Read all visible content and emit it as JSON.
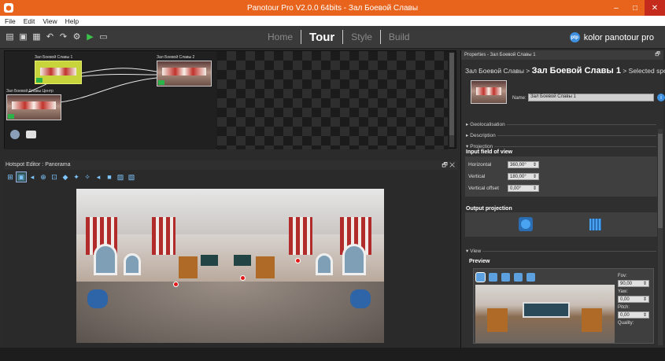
{
  "window": {
    "title": "Panotour Pro V2.0.0 64bits - Зал Боевой Славы",
    "minimize": "–",
    "maximize": "□",
    "close": "✕"
  },
  "menu": [
    "File",
    "Edit",
    "View",
    "Help"
  ],
  "modes": {
    "home": "Home",
    "tour": "Tour",
    "style": "Style",
    "build": "Build",
    "active": "Tour"
  },
  "brand": {
    "logo_text": "ptp",
    "name": "kolor panotour pro"
  },
  "tour_graph": {
    "nodes": [
      {
        "label": "Зал Боевой Славы 1",
        "selected": true
      },
      {
        "label": "Зал Боевой Славы 2",
        "selected": false
      },
      {
        "label": "Зал Боевой Славы Центр",
        "selected": false
      }
    ]
  },
  "hotspot_editor": {
    "title": "Hotspot Editor : Panorama",
    "controls": "🗗 ✕"
  },
  "properties": {
    "title": "Properties - Зал Боевой Славы 1",
    "pin": "🗗",
    "breadcrumb_parent": "Зал Боевой Славы",
    "breadcrumb_sep1": " > ",
    "breadcrumb_current": "Зал Боевой Славы 1",
    "breadcrumb_tail": " > Selected spots",
    "name_label": "Name:",
    "name_value": "Зал Боевой Славы 1",
    "info": "i",
    "sections": {
      "geolocalisation": "Geolocalisation",
      "description": "Description",
      "projection": "Projection",
      "view": "View"
    },
    "input_fov_heading": "Input field of view",
    "fov": {
      "horizontal_label": "Horizontal",
      "horizontal_value": "360,00°",
      "vertical_label": "Vertical",
      "vertical_value": "180,00°",
      "offset_label": "Vertical offset",
      "offset_value": "0,00°"
    },
    "output_projection_heading": "Output projection",
    "preview_heading": "Preview",
    "preview_fields": {
      "fov_label": "Fov:",
      "fov_value": "90,00",
      "yaw_label": "Yaw:",
      "yaw_value": "0,00",
      "pitch_label": "Pitch:",
      "pitch_value": "0,00",
      "quality_label": "Quality:"
    }
  },
  "colors": {
    "titlebar": "#e8641d",
    "selected_node": "#c8d43b",
    "hotspot": "#e31a1a",
    "accent_blue": "#3d8fe0"
  }
}
